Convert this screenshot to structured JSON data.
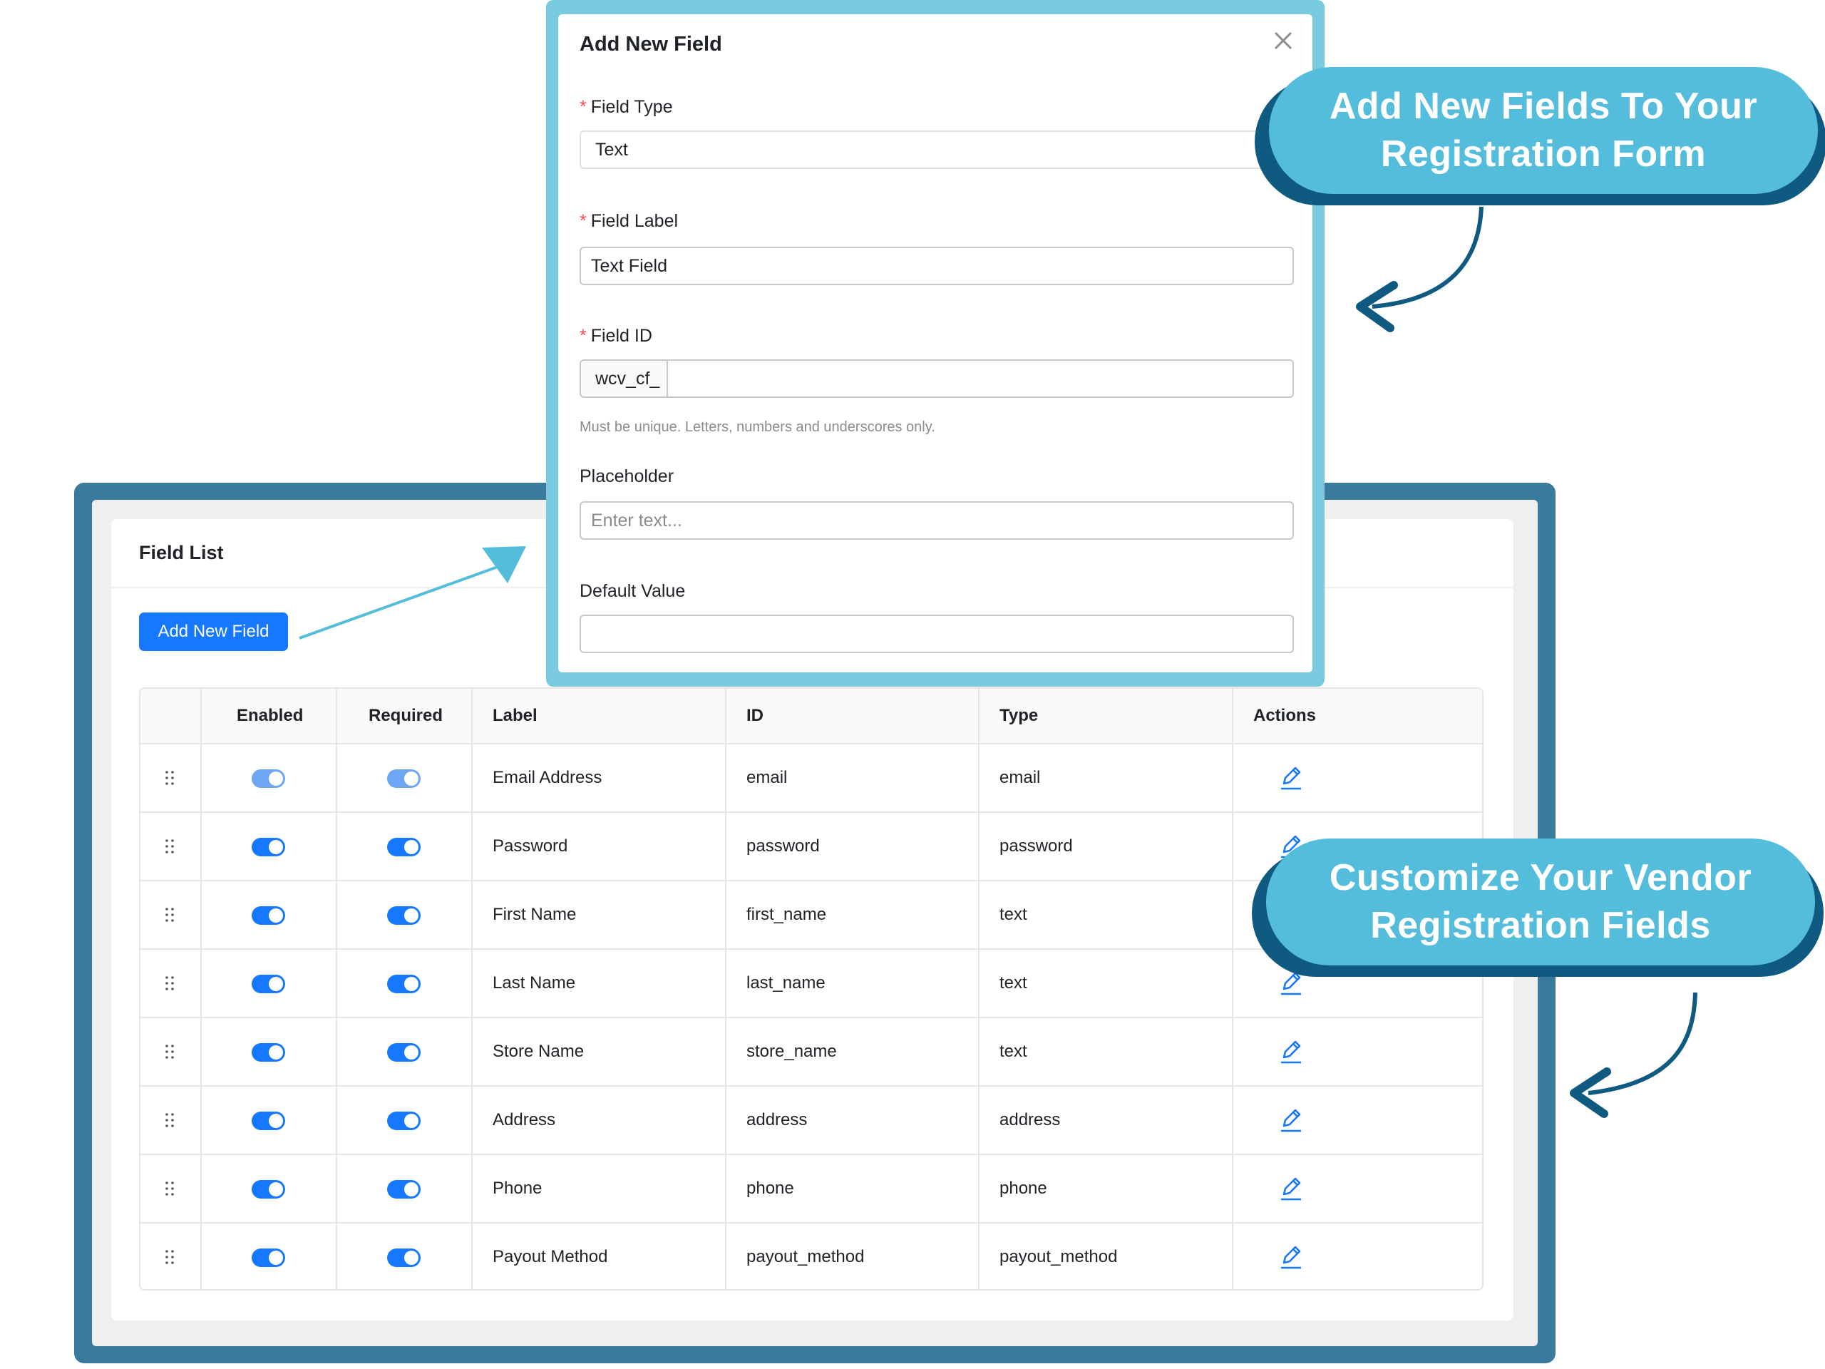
{
  "field_list": {
    "title": "Field List",
    "add_button_label": "Add New Field",
    "columns": [
      "Enabled",
      "Required",
      "Label",
      "ID",
      "Type",
      "Actions"
    ],
    "rows": [
      {
        "label": "Email Address",
        "id": "email",
        "type": "email",
        "enabled": true,
        "required": true,
        "locked": true
      },
      {
        "label": "Password",
        "id": "password",
        "type": "password",
        "enabled": true,
        "required": true,
        "locked": false
      },
      {
        "label": "First Name",
        "id": "first_name",
        "type": "text",
        "enabled": true,
        "required": true,
        "locked": false
      },
      {
        "label": "Last Name",
        "id": "last_name",
        "type": "text",
        "enabled": true,
        "required": true,
        "locked": false
      },
      {
        "label": "Store Name",
        "id": "store_name",
        "type": "text",
        "enabled": true,
        "required": true,
        "locked": false
      },
      {
        "label": "Address",
        "id": "address",
        "type": "address",
        "enabled": true,
        "required": true,
        "locked": false
      },
      {
        "label": "Phone",
        "id": "phone",
        "type": "phone",
        "enabled": true,
        "required": true,
        "locked": false
      },
      {
        "label": "Payout Method",
        "id": "payout_method",
        "type": "payout_method",
        "enabled": true,
        "required": true,
        "locked": false
      }
    ]
  },
  "modal": {
    "title": "Add New Field",
    "field_type": {
      "label": "Field Type",
      "value": "Text"
    },
    "field_label": {
      "label": "Field Label",
      "value": "Text Field"
    },
    "field_id": {
      "label": "Field ID",
      "prefix": "wcv_cf_",
      "value": "",
      "help": "Must be unique. Letters, numbers and underscores only."
    },
    "placeholder": {
      "label": "Placeholder",
      "placeholder": "Enter text..."
    },
    "default_value": {
      "label": "Default Value",
      "value": ""
    }
  },
  "callouts": {
    "top": {
      "line1": "Add New Fields To Your",
      "line2": "Registration Form"
    },
    "bottom": {
      "line1": "Customize Your Vendor",
      "line2": "Registration Fields"
    }
  },
  "colors": {
    "primary": "#1677ff",
    "frame": "#3a7a9c",
    "modal_frame": "#79c9e1",
    "callout": "#55bddc",
    "callout_shadow": "#0f5a80",
    "required_star": "#ff4d4f"
  }
}
